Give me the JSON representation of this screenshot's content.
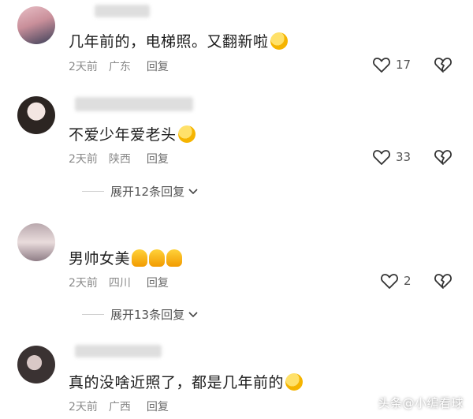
{
  "comments": [
    {
      "text": "几年前的，电梯照。又翻新啦",
      "time": "2天前",
      "location": "广东",
      "reply_label": "回复",
      "likes": "17"
    },
    {
      "text": "不爱少年爱老头",
      "time": "2天前",
      "location": "陕西",
      "reply_label": "回复",
      "likes": "33",
      "expand_label": "展开12条回复"
    },
    {
      "text": "男帅女美",
      "time": "2天前",
      "location": "四川",
      "reply_label": "回复",
      "likes": "2",
      "expand_label": "展开13条回复"
    },
    {
      "text": "真的没啥近照了，都是几年前的",
      "time": "2天前",
      "location": "广西",
      "reply_label": "回复"
    }
  ],
  "watermark": "头条@小编看球",
  "colors": {
    "text": "#1c1c1c",
    "meta": "#8a8a8a",
    "background": "#ffffff"
  }
}
